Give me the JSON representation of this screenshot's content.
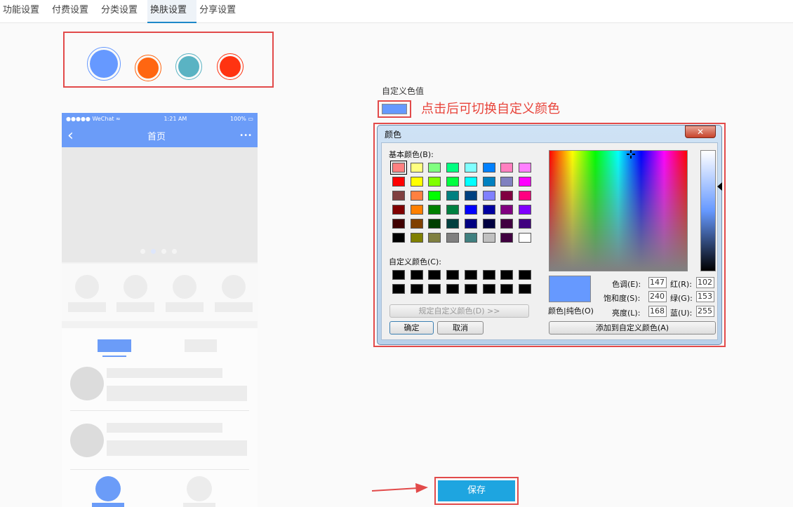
{
  "tabs": [
    {
      "label": "功能设置"
    },
    {
      "label": "付费设置"
    },
    {
      "label": "分类设置"
    },
    {
      "label": "换肤设置"
    },
    {
      "label": "分享设置"
    }
  ],
  "theme_swatches": [
    {
      "color": "#6699ff"
    },
    {
      "color": "#ff6611"
    },
    {
      "color": "#5ab3c3"
    },
    {
      "color": "#ff3311"
    }
  ],
  "phone": {
    "carrier": "●●●●● WeChat ≈",
    "time": "1:21 AM",
    "battery": "100% ▭",
    "title": "首页",
    "back": "‹",
    "more": "•••",
    "accent": "#6b9cf8"
  },
  "custom_color": {
    "label": "自定义色值",
    "value": "#6699ff",
    "hint": "点击后可切换自定义颜色"
  },
  "color_dialog": {
    "title": "颜色",
    "close": "✕",
    "basic_label": "基本颜色(B):",
    "custom_label": "自定义颜色(C):",
    "define_button": "规定自定义颜色(D) >>",
    "ok": "确定",
    "cancel": "取消",
    "add_button": "添加到自定义颜色(A)",
    "preview_label": "颜色|纯色(O)",
    "fields": [
      {
        "label": "色调(E):",
        "value": "147"
      },
      {
        "label": "饱和度(S):",
        "value": "240"
      },
      {
        "label": "亮度(L):",
        "value": "168"
      }
    ],
    "rgb_fields": [
      {
        "label": "红(R):",
        "value": "102"
      },
      {
        "label": "绿(G):",
        "value": "153"
      },
      {
        "label": "蓝(U):",
        "value": "255"
      }
    ],
    "basic_colors": [
      [
        "#ff8080",
        "#ffff80",
        "#80ff80",
        "#00ff80",
        "#80ffff",
        "#0080ff",
        "#ff80c0",
        "#ff80ff"
      ],
      [
        "#ff0000",
        "#ffff00",
        "#80ff00",
        "#00ff40",
        "#00ffff",
        "#0080c0",
        "#8080c0",
        "#ff00ff"
      ],
      [
        "#804040",
        "#ff8040",
        "#00ff00",
        "#008080",
        "#004080",
        "#8080ff",
        "#800040",
        "#ff0080"
      ],
      [
        "#800000",
        "#ff8000",
        "#008000",
        "#008040",
        "#0000ff",
        "#0000a0",
        "#800080",
        "#8000ff"
      ],
      [
        "#400000",
        "#804000",
        "#004000",
        "#004040",
        "#000080",
        "#000040",
        "#400040",
        "#400080"
      ],
      [
        "#000000",
        "#808000",
        "#808040",
        "#808080",
        "#408080",
        "#c0c0c0",
        "#400040",
        "#ffffff"
      ]
    ]
  },
  "save_label": "保存"
}
